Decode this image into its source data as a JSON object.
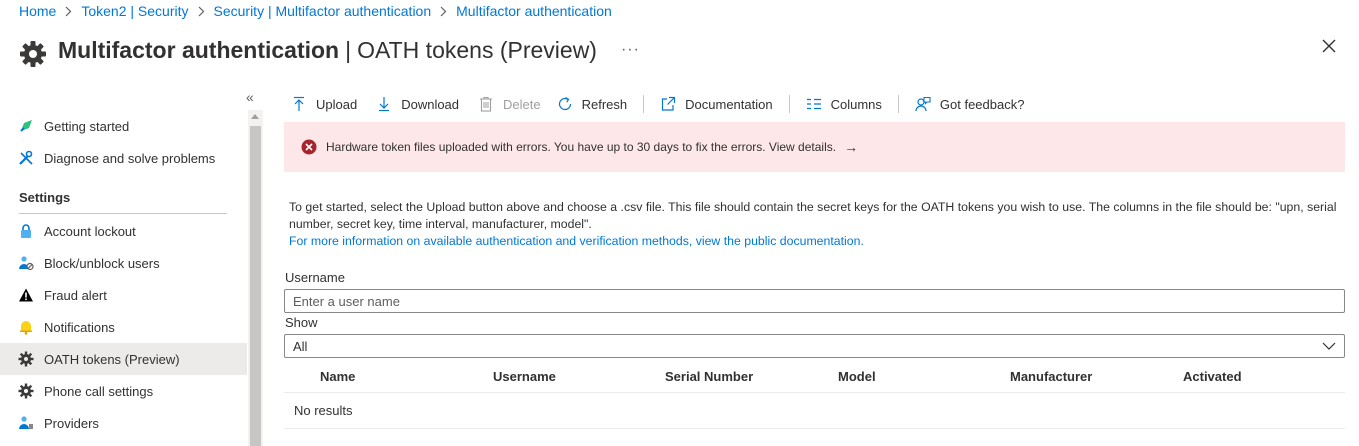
{
  "breadcrumb": [
    {
      "label": "Home"
    },
    {
      "label": "Token2 | Security"
    },
    {
      "label": "Security | Multifactor authentication"
    },
    {
      "label": "Multifactor authentication"
    }
  ],
  "header": {
    "title": "Multifactor authentication",
    "separator": "|",
    "subtitle": "OATH tokens (Preview)",
    "more_label": "···"
  },
  "sidebar": {
    "collapse_label": "«",
    "section_title": "Settings",
    "items": [
      {
        "label": "Getting started",
        "icon": "rocket-icon"
      },
      {
        "label": "Diagnose and solve problems",
        "icon": "wrench-icon"
      },
      {
        "label": "Account lockout",
        "icon": "lock-icon"
      },
      {
        "label": "Block/unblock users",
        "icon": "users-block-icon"
      },
      {
        "label": "Fraud alert",
        "icon": "warning-icon"
      },
      {
        "label": "Notifications",
        "icon": "bell-icon"
      },
      {
        "label": "OATH tokens (Preview)",
        "icon": "gear-icon",
        "active": true
      },
      {
        "label": "Phone call settings",
        "icon": "gear-icon"
      },
      {
        "label": "Providers",
        "icon": "providers-icon"
      }
    ]
  },
  "toolbar": {
    "upload": "Upload",
    "download": "Download",
    "delete": "Delete",
    "refresh": "Refresh",
    "documentation": "Documentation",
    "columns": "Columns",
    "feedback": "Got feedback?"
  },
  "error_banner": {
    "text": "Hardware token files uploaded with errors. You have up to 30 days to fix the errors. View details.",
    "arrow": "→"
  },
  "intro": {
    "text": "To get started, select the Upload button above and choose a .csv file. This file should contain the secret keys for the OATH tokens you wish to use. The columns in the file should be: \"upn, serial number, secret key, time interval, manufacturer, model\".",
    "link": "For more information on available authentication and verification methods, view the public documentation."
  },
  "filters": {
    "username_label": "Username",
    "username_placeholder": "Enter a user name",
    "username_value": "",
    "show_label": "Show",
    "show_value": "All"
  },
  "table": {
    "columns": [
      "Name",
      "Username",
      "Serial Number",
      "Model",
      "Manufacturer",
      "Activated"
    ],
    "empty_text": "No results"
  },
  "colors": {
    "accent": "#0078d4",
    "error_bg": "#fde7e9",
    "error_icon": "#a4262c",
    "active_nav_bg": "#edebe9"
  }
}
